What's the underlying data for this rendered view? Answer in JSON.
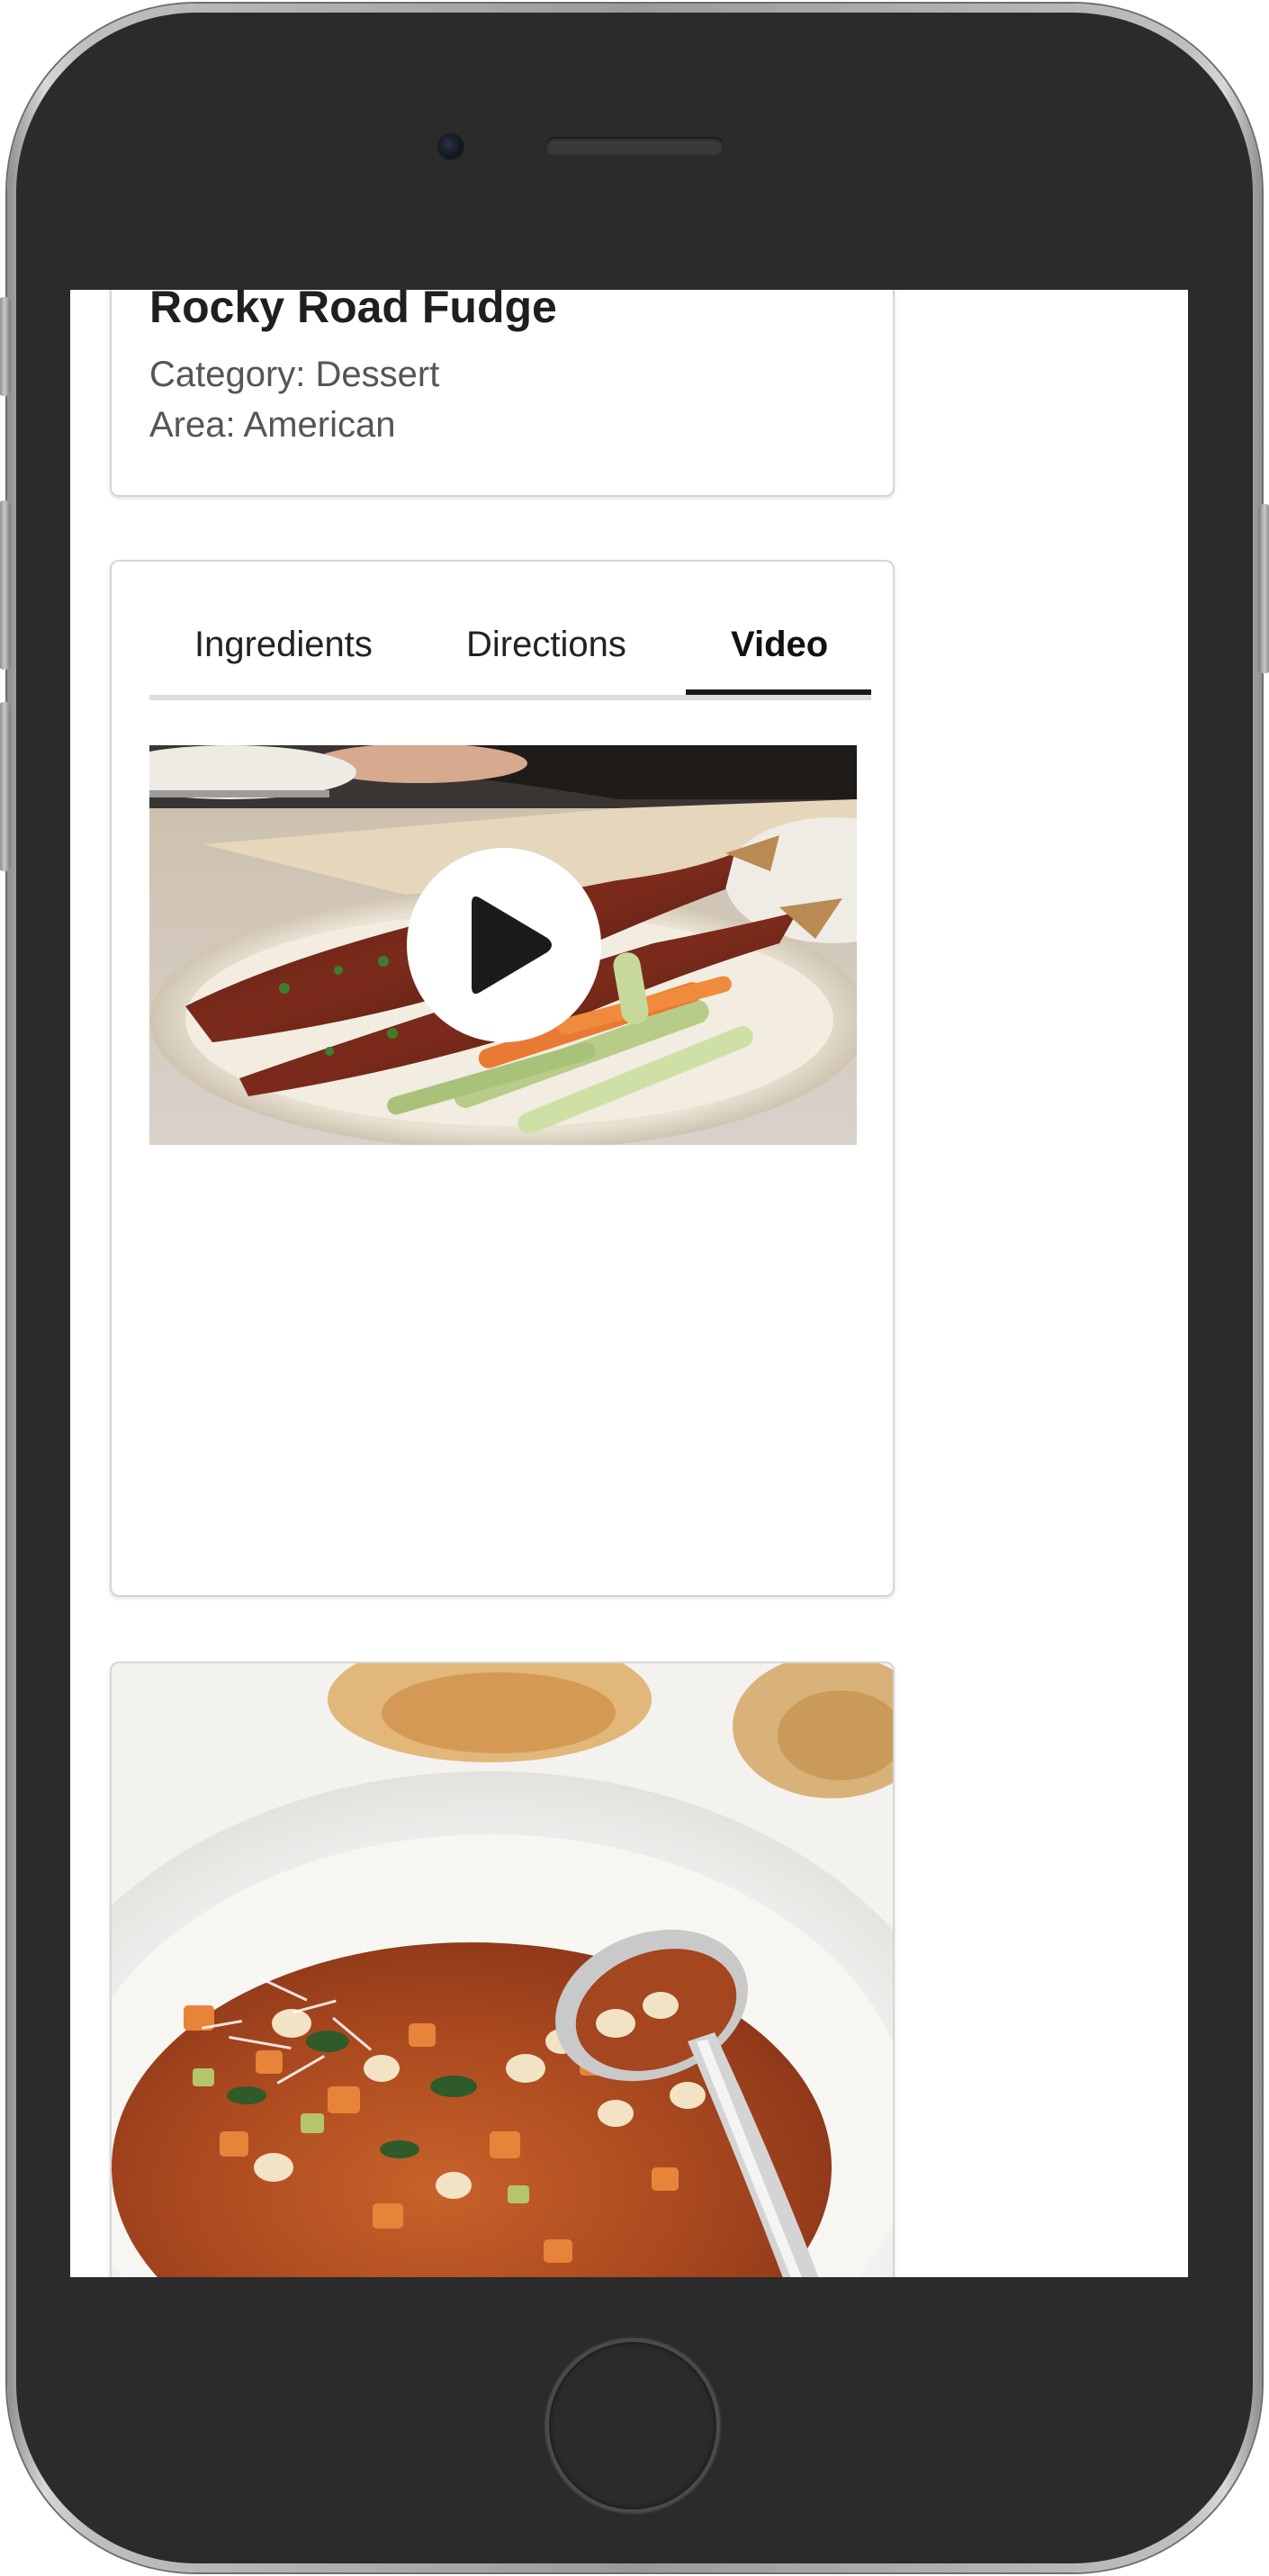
{
  "recipe": {
    "title": "Rocky Road Fudge",
    "category": "Category: Dessert",
    "area": "Area: American"
  },
  "tabs": [
    {
      "label": "Ingredients",
      "active": false
    },
    {
      "label": "Directions",
      "active": false
    },
    {
      "label": "Video",
      "active": true
    }
  ],
  "video": {
    "thumbnail": "grilled-fish-plate-image",
    "play_icon": "play-icon"
  },
  "next_card": {
    "image": "vegetable-bean-soup-bowl-image"
  },
  "colors": {
    "phone_body": "#2b2b2b",
    "active_tab_underline": "#1a1a1a",
    "tab_track": "#dcdcdc",
    "card_border": "#d6d6d6",
    "meta_text": "#555555"
  }
}
